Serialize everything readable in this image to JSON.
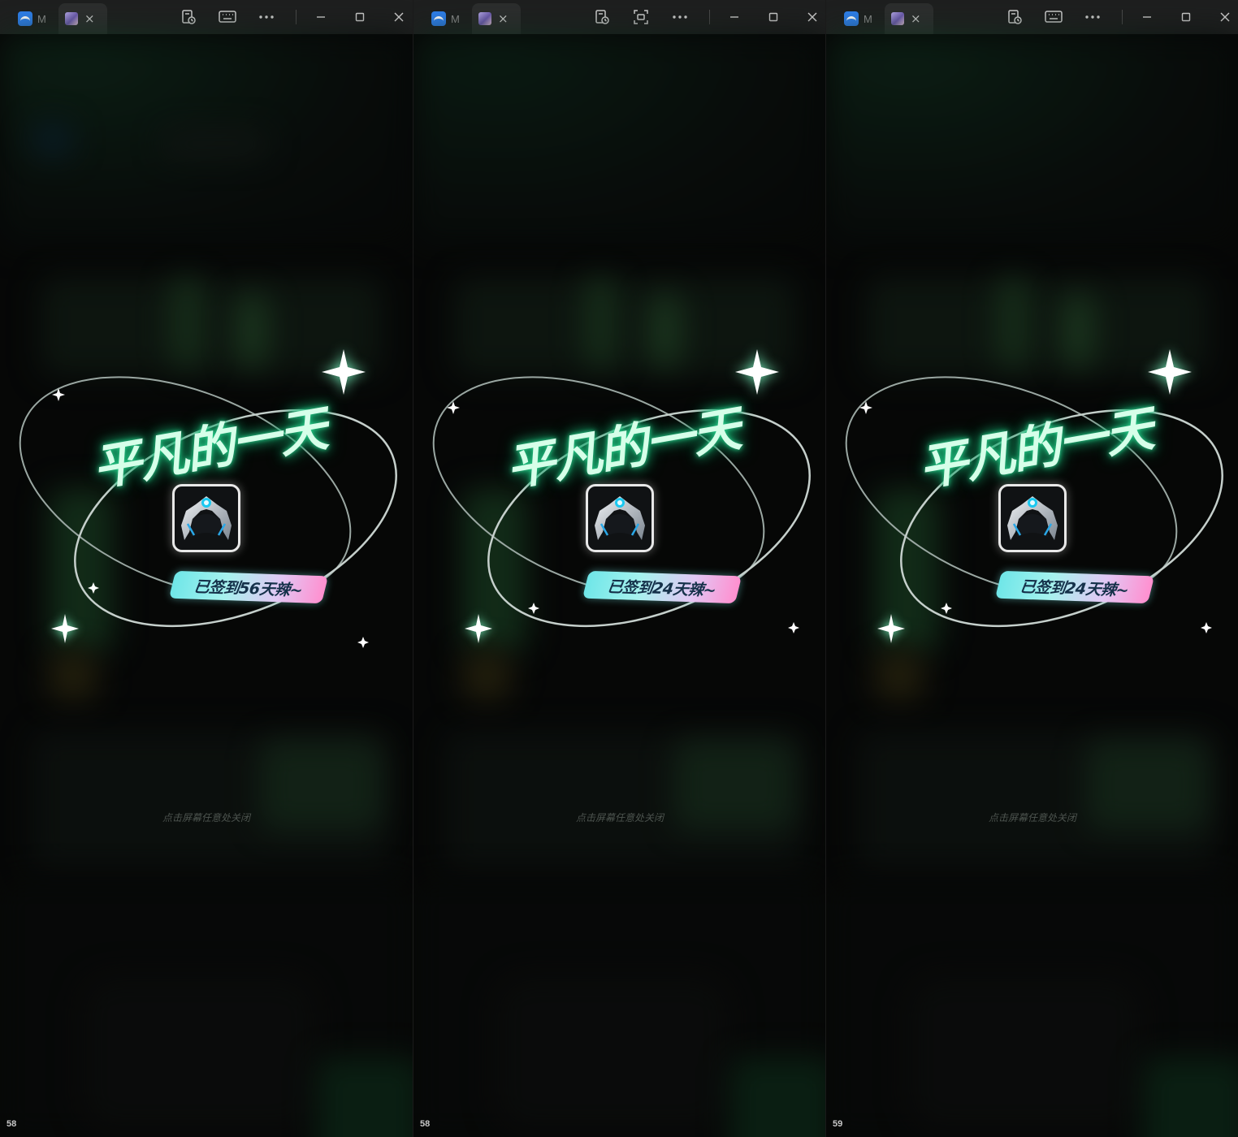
{
  "panels": [
    {
      "tab_app_label": "M",
      "tab_close": "×",
      "title": "平凡的一天",
      "checkin_text": "已签到56天辣~",
      "close_hint": "点击屏幕任意处关闭",
      "frame_number": "58",
      "toolbar_second_icon": "keyboard-icon"
    },
    {
      "tab_app_label": "M",
      "tab_close": "×",
      "title": "平凡的一天",
      "checkin_text": "已签到24天辣~",
      "close_hint": "点击屏幕任意处关闭",
      "frame_number": "58",
      "toolbar_second_icon": "screen-capture-icon"
    },
    {
      "tab_app_label": "M",
      "tab_close": "×",
      "title": "平凡的一天",
      "checkin_text": "已签到24天辣~",
      "close_hint": "点击屏幕任意处关闭",
      "frame_number": "59",
      "toolbar_second_icon": "keyboard-icon"
    }
  ],
  "colors": {
    "titlebar": "#1e1f1f",
    "title_glow": "#2bd38f",
    "pill_start": "#6fe6e8",
    "pill_end": "#ff8fcf",
    "background": "#0b0d0c"
  }
}
